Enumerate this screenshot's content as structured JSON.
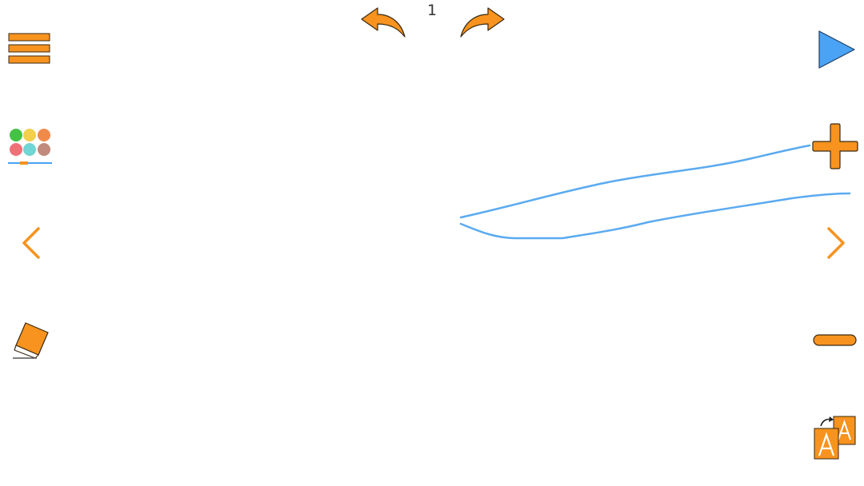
{
  "app": {
    "page_number": "1"
  },
  "toolbar": {
    "undo_icon": "undo-arrow-icon",
    "redo_icon": "redo-arrow-icon",
    "menu_icon": "hamburger-menu-icon",
    "palette_icon": "color-palette-icon",
    "prev_icon": "chevron-left-icon",
    "next_icon": "chevron-right-icon",
    "eraser_icon": "eraser-icon",
    "play_icon": "play-icon",
    "zoom_in_icon": "plus-icon",
    "zoom_out_icon": "minus-icon",
    "font_size_icon": "font-size-icon"
  },
  "palette": {
    "colors": [
      "#44c244",
      "#f2cf4c",
      "#f08a4b",
      "#f07078",
      "#6fd6d3",
      "#c08a7c"
    ]
  },
  "colors": {
    "accent": "#f7931e",
    "accent_stroke": "#3a2a14",
    "play": "#4aa3f5",
    "ink": "#5aaaf0"
  }
}
